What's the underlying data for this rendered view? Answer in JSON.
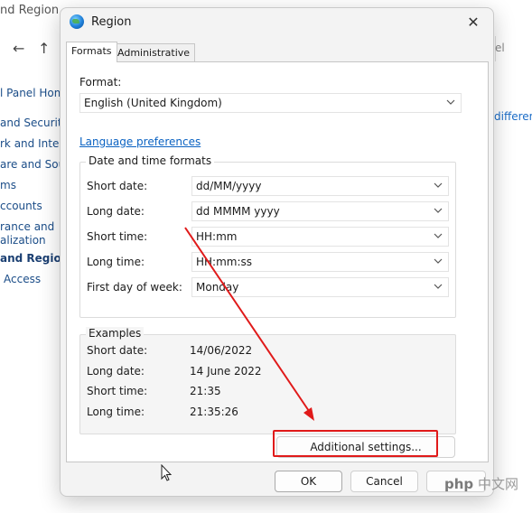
{
  "background": {
    "window_title": "nd Region",
    "back_arrow": "←",
    "up_arrow": "↑",
    "sidebar_items": [
      "l Panel Hom",
      "and Security",
      "rk and Intern",
      "are and Soun",
      "ms",
      "ccounts",
      "rance and",
      "alization",
      "and Region",
      "Access"
    ],
    "right_label": "el",
    "right_link": "differen"
  },
  "dialog": {
    "title": "Region",
    "close_label": "✕",
    "tabs": [
      "Formats",
      "Administrative"
    ],
    "format_label": "Format:",
    "format_value": "English (United Kingdom)",
    "language_link": "Language preferences",
    "dt_group_title": "Date and time formats",
    "fields": [
      {
        "label": "Short date:",
        "value": "dd/MM/yyyy"
      },
      {
        "label": "Long date:",
        "value": "dd MMMM yyyy"
      },
      {
        "label": "Short time:",
        "value": "HH:mm"
      },
      {
        "label": "Long time:",
        "value": "HH:mm:ss"
      },
      {
        "label": "First day of week:",
        "value": "Monday"
      }
    ],
    "examples_title": "Examples",
    "examples": [
      {
        "label": "Short date:",
        "value": "14/06/2022"
      },
      {
        "label": "Long date:",
        "value": "14 June 2022"
      },
      {
        "label": "Short time:",
        "value": "21:35"
      },
      {
        "label": "Long time:",
        "value": "21:35:26"
      }
    ],
    "additional_button": "Additional settings...",
    "ok_button": "OK",
    "cancel_button": "Cancel"
  },
  "annotation": {
    "color": "#e01a1a"
  },
  "watermark": {
    "left": "php",
    "right": "中文网"
  }
}
